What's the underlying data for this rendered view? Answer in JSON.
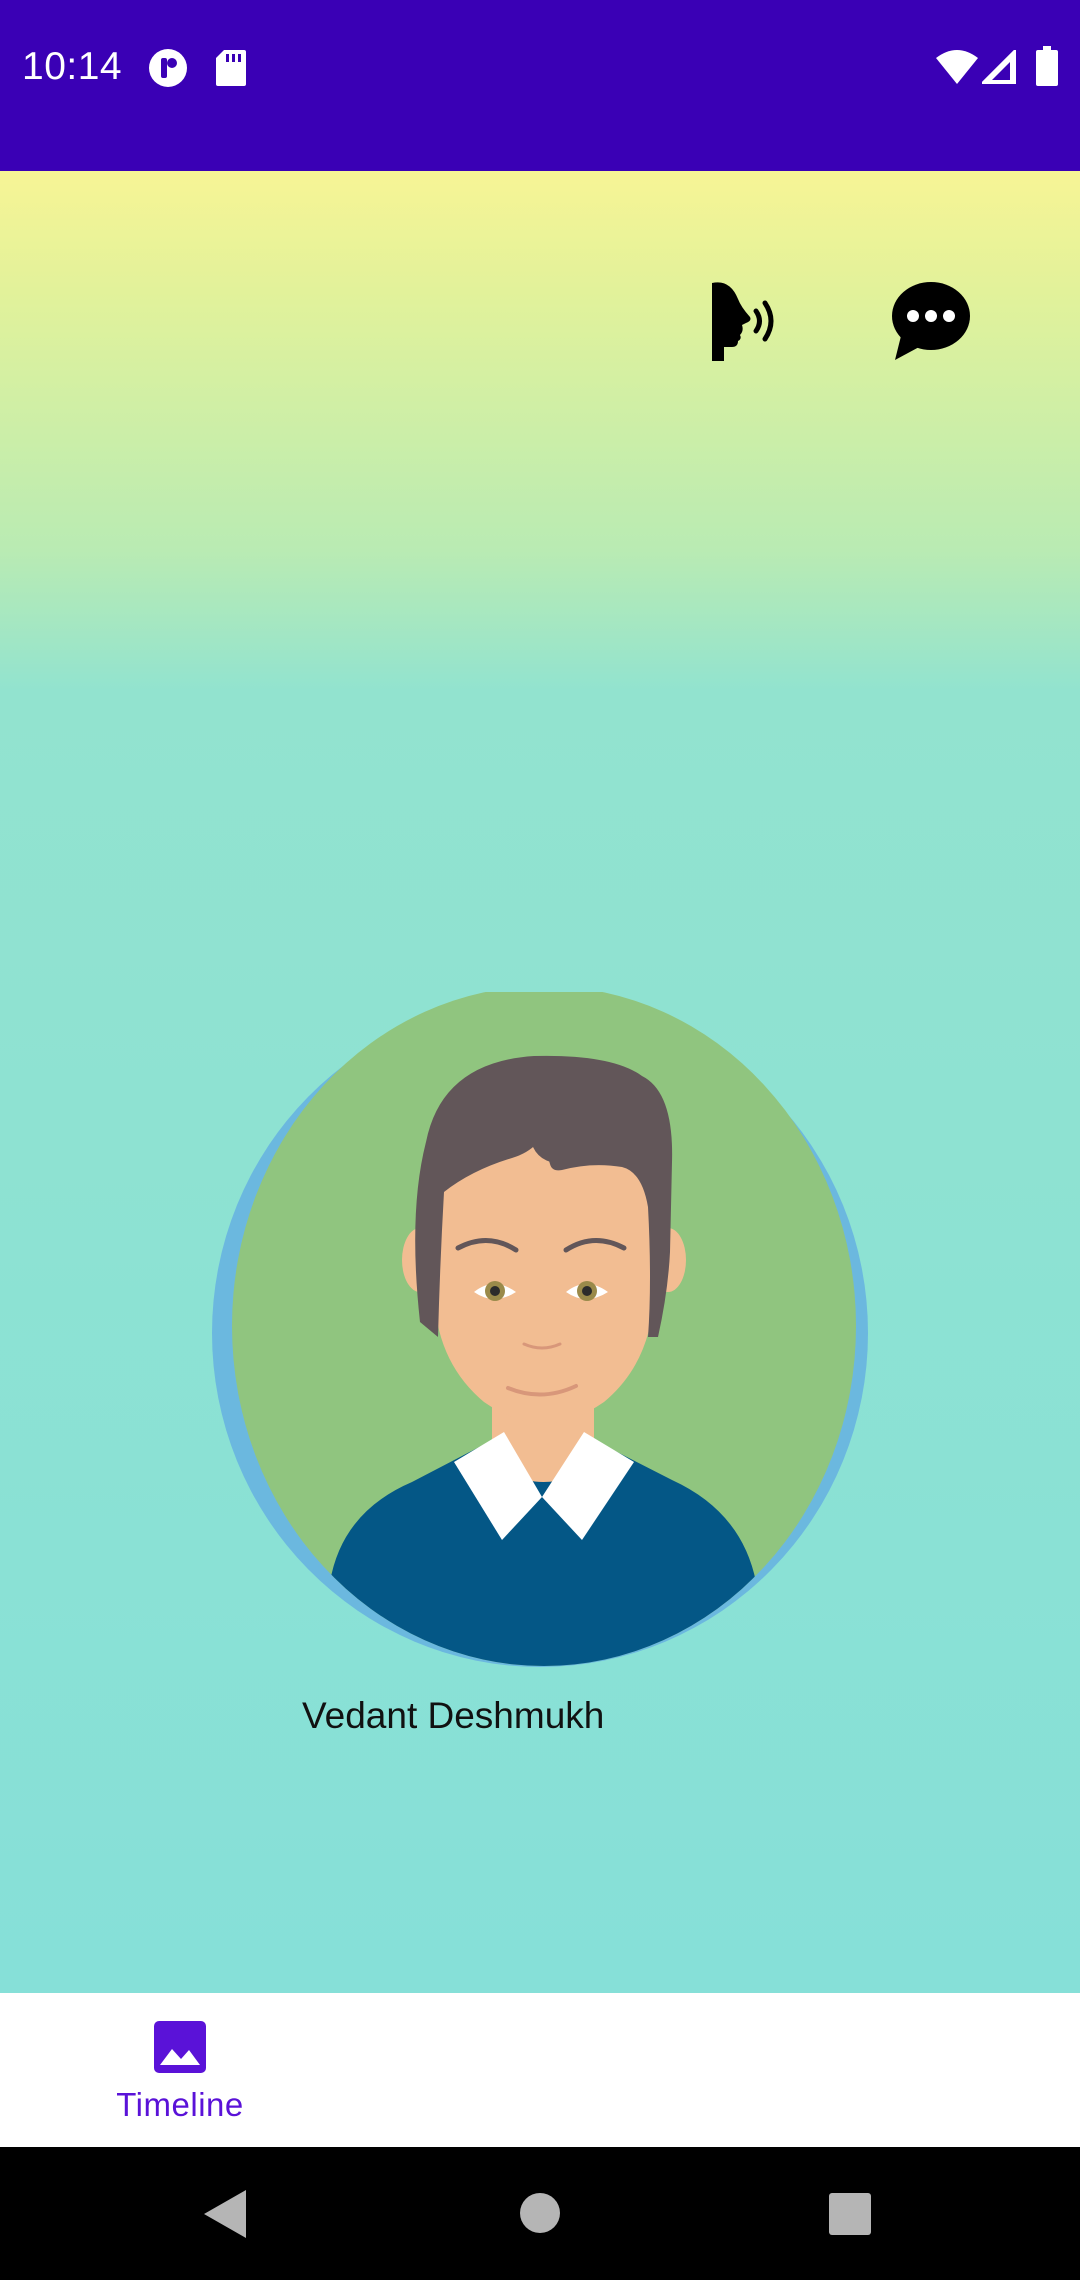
{
  "status_bar": {
    "time": "10:14",
    "icons": [
      "tiktok-icon",
      "sd-card-icon",
      "wifi-icon",
      "signal-icon",
      "battery-icon"
    ]
  },
  "header_actions": {
    "icons": [
      "speak-icon",
      "chat-bubble-icon"
    ]
  },
  "profile": {
    "name": "Vedant Deshmukh",
    "avatar_icon": "male-avatar-illustration"
  },
  "bottom_nav": {
    "items": [
      {
        "label": "Timeline",
        "icon": "image-icon",
        "selected": true
      }
    ],
    "accent_color": "#5a12d8"
  },
  "system_nav": {
    "icons": [
      "back-icon",
      "home-icon",
      "recents-icon"
    ]
  },
  "colors": {
    "status_bar": "#3a00b5",
    "gradient_top": "#f7f495",
    "gradient_bottom": "#86e0d8"
  }
}
